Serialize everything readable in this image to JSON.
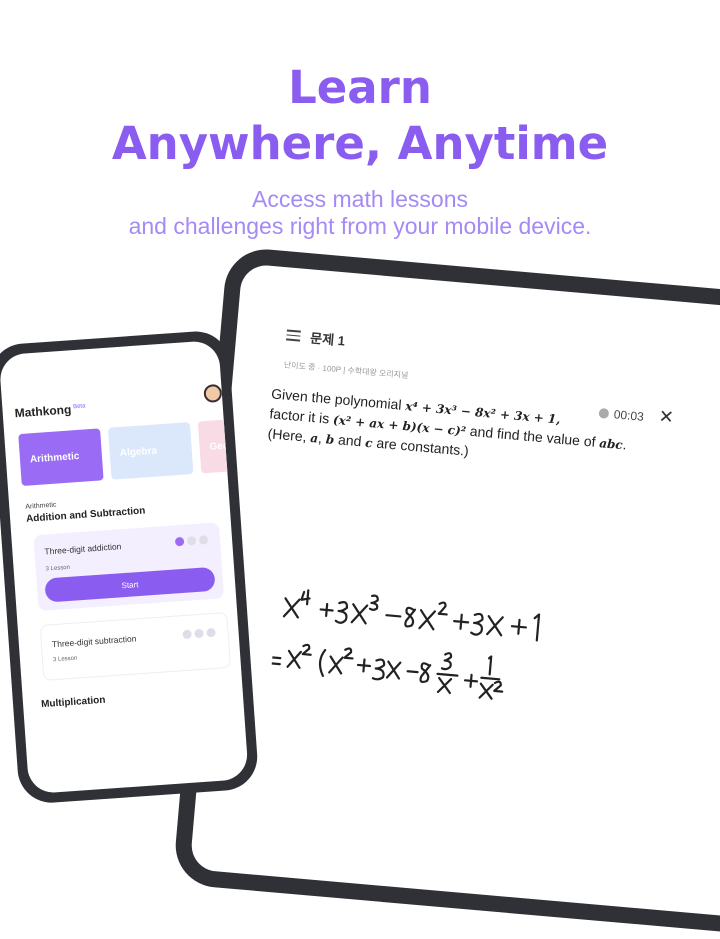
{
  "hero": {
    "title_line1": "Learn",
    "title_line2": "Anywhere, Anytime",
    "subtitle_line1": "Access math lessons",
    "subtitle_line2": "and challenges right from your mobile device."
  },
  "colors": {
    "accent": "#8a5cf0",
    "accent_light": "#a58af5",
    "device_frame": "#2f3136"
  },
  "tablet": {
    "problem_title": "문제 1",
    "meta": "난이도 중 · 100P  |  수학대왕 오리지널",
    "timer": "00:03",
    "close_icon": "close-icon",
    "problem": {
      "t1": "Given the polynomial ",
      "poly": "x⁴ + 3x³ − 8x² + 3x + 1,",
      "t2": "factor it is ",
      "factor": "(x² + ax + b)(x − c)²",
      "t3": " and find the value of ",
      "abc": "abc",
      "t4": ".",
      "t5": "(Here, ",
      "a": "a",
      "t6": ", ",
      "b": "b",
      "t7": " and ",
      "c": "c",
      "t8": " are constants.)"
    }
  },
  "phone": {
    "brand": "Mathkong",
    "brand_badge": "Beta",
    "categories": [
      "Arithmetic",
      "Algebra",
      "Geo"
    ],
    "section_category": "Arithmetic",
    "section_title": "Addition and Subtraction",
    "lessons": [
      {
        "title": "Three-digit addiction",
        "sub": "3 Lesson",
        "progress_done": 1,
        "progress_total": 3,
        "button": "Start"
      },
      {
        "title": "Three-digit subtraction",
        "sub": "3 Lesson",
        "progress_done": 0,
        "progress_total": 3
      }
    ],
    "next_section_title": "Multiplication"
  }
}
